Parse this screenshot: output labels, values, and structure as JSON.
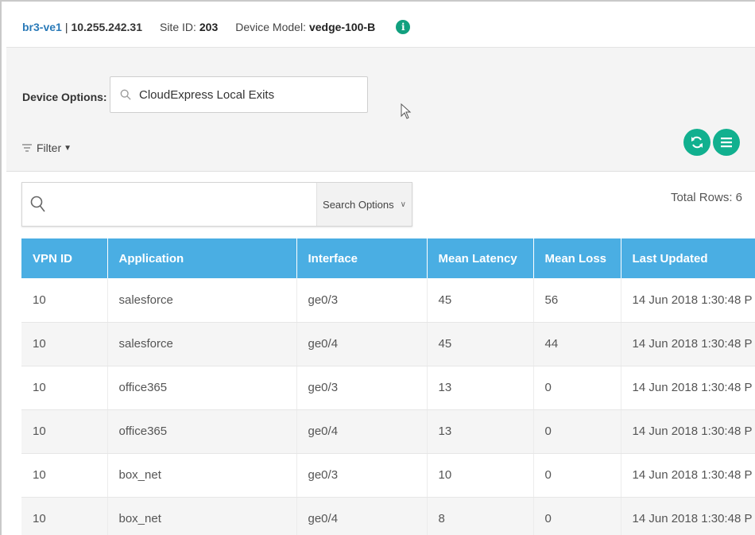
{
  "header": {
    "device_name": "br3-ve1",
    "separator": "|",
    "ip": "10.255.242.31",
    "site_label": "Site ID:",
    "site_value": "203",
    "model_label": "Device Model:",
    "model_value": "vedge-100-B",
    "info_glyph": "i"
  },
  "options": {
    "device_options_label": "Device Options:",
    "device_options_value": "CloudExpress Local Exits",
    "filter_label": "Filter"
  },
  "search": {
    "placeholder": "",
    "options_label": "Search Options",
    "total_rows": "Total Rows: 6"
  },
  "table": {
    "columns": [
      "VPN ID",
      "Application",
      "Interface",
      "Mean Latency",
      "Mean Loss",
      "Last Updated"
    ],
    "rows": [
      [
        "10",
        "salesforce",
        "ge0/3",
        "45",
        "56",
        "14 Jun 2018 1:30:48 P"
      ],
      [
        "10",
        "salesforce",
        "ge0/4",
        "45",
        "44",
        "14 Jun 2018 1:30:48 P"
      ],
      [
        "10",
        "office365",
        "ge0/3",
        "13",
        "0",
        "14 Jun 2018 1:30:48 P"
      ],
      [
        "10",
        "office365",
        "ge0/4",
        "13",
        "0",
        "14 Jun 2018 1:30:48 P"
      ],
      [
        "10",
        "box_net",
        "ge0/3",
        "10",
        "0",
        "14 Jun 2018 1:30:48 P"
      ],
      [
        "10",
        "box_net",
        "ge0/4",
        "8",
        "0",
        "14 Jun 2018 1:30:48 P"
      ]
    ]
  },
  "icons": {
    "info": "info-icon",
    "search": "search-icon",
    "refresh": "refresh-icon",
    "menu": "menu-icon",
    "filter": "filter-icon",
    "chevron": "chevron-down-icon"
  },
  "colors": {
    "accent_teal": "#11b08f",
    "header_blue": "#4aaee3",
    "link_blue": "#2a7ab8"
  }
}
